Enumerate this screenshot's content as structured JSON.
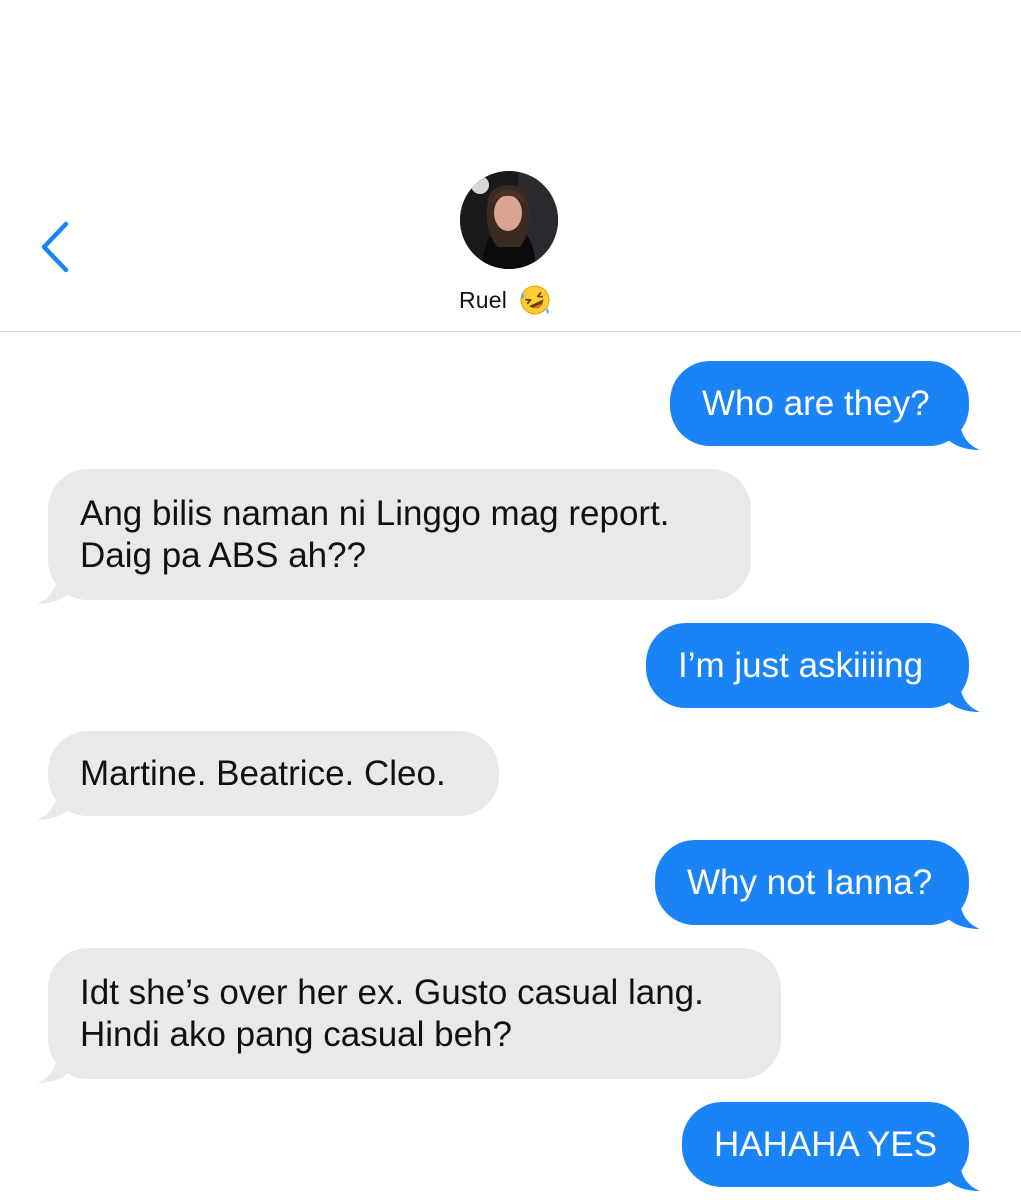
{
  "contact": {
    "name": "Ruel",
    "emoji": "rolling-on-the-floor-laughing-emoji"
  },
  "colors": {
    "sent_bubble": "#1a84f7",
    "received_bubble": "#e9e9eb",
    "back_chevron": "#1a84f7"
  },
  "messages": [
    {
      "direction": "sent",
      "lines": [
        "Who are they?"
      ]
    },
    {
      "direction": "received",
      "lines": [
        "Ang bilis naman ni Linggo mag report.",
        "Daig pa ABS ah??"
      ]
    },
    {
      "direction": "sent",
      "lines": [
        "I’m just askiiiing"
      ]
    },
    {
      "direction": "received",
      "lines": [
        "Martine. Beatrice. Cleo."
      ]
    },
    {
      "direction": "sent",
      "lines": [
        "Why not Ianna?"
      ]
    },
    {
      "direction": "received",
      "lines": [
        "Idt she’s over her ex. Gusto casual lang.",
        "Hindi ako pang casual beh?"
      ]
    },
    {
      "direction": "sent",
      "lines": [
        "HAHAHA YES"
      ]
    }
  ]
}
